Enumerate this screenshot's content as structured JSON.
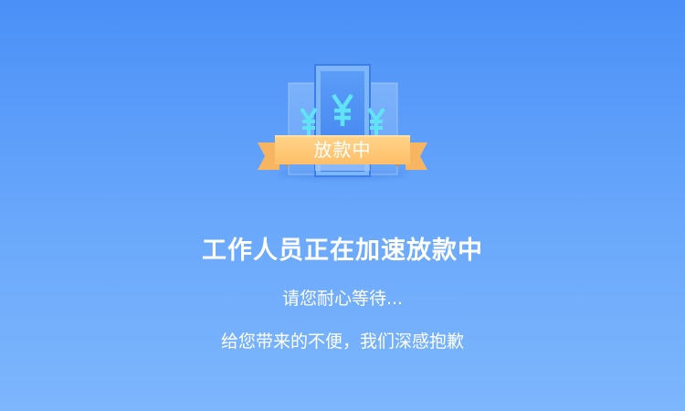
{
  "illustration": {
    "ribbon_text": "放款中",
    "currency_symbol": "¥",
    "colors": {
      "ribbon": "#ffc777",
      "ribbon_dark": "#f3a94e",
      "symbol": "#5fe3f5"
    }
  },
  "message": {
    "title": "工作人员正在加速放款中",
    "subtitle": "请您耐心等待...",
    "apology": "给您带来的不便，我们深感抱歉"
  },
  "colors": {
    "background_top": "#4a90f7",
    "background_bottom": "#7db6fc",
    "text": "#ffffff"
  }
}
